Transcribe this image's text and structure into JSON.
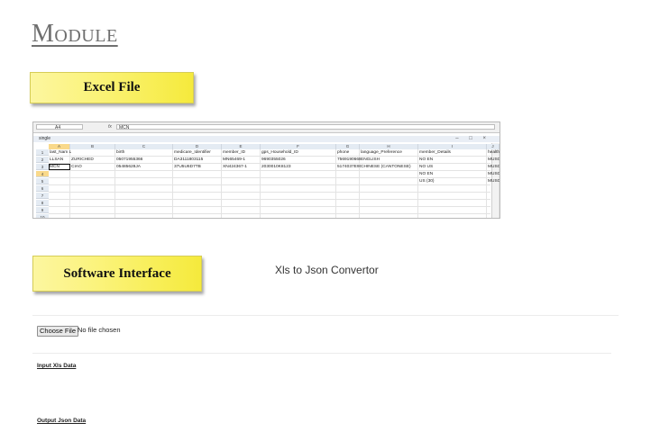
{
  "module_title": "Module",
  "callouts": {
    "excel_file": "Excel File",
    "software_interface": "Software Interface"
  },
  "excel": {
    "name_box": "A4",
    "fx_label": "fx",
    "formula_value": "MCN",
    "window_title": "single",
    "window_controls": "– □ ×",
    "column_letters": [
      "A",
      "B",
      "C",
      "D",
      "E",
      "F",
      "G",
      "H",
      "I",
      "J"
    ],
    "headers": [
      "last_Nam Last_Name",
      "",
      "birth",
      "medicare_Identifier",
      "member_ID",
      "gps_Household_ID",
      "phone",
      "language_Preference",
      "member_Details",
      "health_Con"
    ],
    "row_numbers": [
      "1",
      "2",
      "3",
      "4",
      "5",
      "6",
      "7",
      "8",
      "9",
      "10"
    ],
    "rows": [
      [
        "LLSAN",
        "ZURICHED",
        "05071955366",
        "DA3111803115",
        "MN65469-1",
        "9690355026",
        "7569190668",
        "ENGLISH",
        "NO EN",
        "MUSCLEMD"
      ],
      [
        "MCN",
        "CIAO",
        "05485628JA",
        "37U5U6D7TB",
        "XN424367-1",
        "2030010K8123",
        "5174037E9GE",
        "CHINESE (CANTONESE)",
        "NO US",
        "MUSCLEMD"
      ],
      [
        "",
        "",
        "",
        "",
        "",
        "",
        "",
        "",
        "NO EN",
        "MUSCLEMD"
      ],
      [
        "",
        "",
        "",
        "",
        "",
        "",
        "",
        "",
        "US (30)",
        "MUSCLEMD"
      ]
    ]
  },
  "app": {
    "title": "Xls to Json Convertor",
    "choose_file_label": "Choose File",
    "no_file_text": "No file chosen",
    "input_label": "Input Xls Data",
    "output_label": "Output Json Data"
  }
}
